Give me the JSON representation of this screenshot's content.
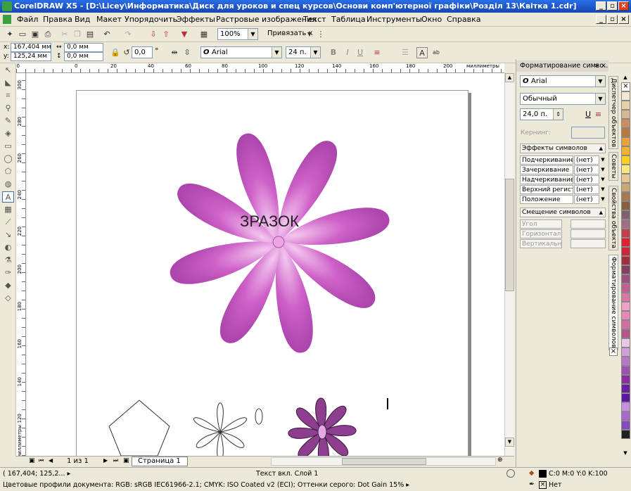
{
  "window": {
    "title": "CorelDRAW X5 - [D:\\Licey\\Информатика\\Диск для уроков и спец курсов\\Основи комп'ютерної графіки\\Розділ 13\\Квітка 1.cdr]"
  },
  "menu": [
    "Файл",
    "Правка",
    "Вид",
    "Макет",
    "Упорядочить",
    "Эффекты",
    "Растровые изображения",
    "Текст",
    "Таблица",
    "Инструменты",
    "Окно",
    "Справка"
  ],
  "toolbar": {
    "zoom": "100%",
    "snap": "Привязать к"
  },
  "propbar": {
    "x": "167,404 мм",
    "y": "125,24 мм",
    "w": "0,0 мм",
    "h": "0,0 мм",
    "angle": "0,0",
    "font": "Arial",
    "size": "24 п."
  },
  "ruler": {
    "h_ticks": [
      "20",
      "0",
      "20",
      "40",
      "60",
      "80",
      "100",
      "120",
      "140",
      "160",
      "180",
      "200"
    ],
    "h_unit": "миллиметры",
    "v_ticks": [
      "300",
      "280",
      "260",
      "240",
      "220",
      "200",
      "180",
      "160",
      "140",
      "120"
    ],
    "v_unit": "миллиметры"
  },
  "canvas": {
    "label": "ЗРАЗОК"
  },
  "nav": {
    "pages": "1 из 1",
    "tab": "Страница 1"
  },
  "docker": {
    "title": "Форматирование симво...",
    "font": "Arial",
    "style": "Обычный",
    "size": "24,0 п.",
    "kerning": "Кернинг:",
    "effects_title": "Эффекты символов",
    "effects": [
      {
        "label": "Подчеркивание",
        "value": "(нет)"
      },
      {
        "label": "Зачеркивание",
        "value": "(нет)"
      },
      {
        "label": "Надчеркивание",
        "value": "(нет)"
      },
      {
        "label": "Верхний регистр",
        "value": "(нет)"
      },
      {
        "label": "Положение",
        "value": "(нет)"
      }
    ],
    "shift_title": "Смещение символов",
    "shifts": [
      "Угол",
      "Горизонтал...",
      "Вертикальн..."
    ]
  },
  "side_tabs": [
    "Диспетчер объектов",
    "Советы",
    "Свойства объекта",
    "Форматирование символов"
  ],
  "palette": [
    "#f5e8d0",
    "#e8d0a8",
    "#d4b896",
    "#c89060",
    "#b87840",
    "#e8a040",
    "#f0b030",
    "#f8d020",
    "#f8e880",
    "#e8c890",
    "#c8a878",
    "#a87850",
    "#886040",
    "#806070",
    "#a07080",
    "#c04050",
    "#e02030",
    "#c82838",
    "#a03040",
    "#804060",
    "#a05080",
    "#c06090",
    "#d878a8",
    "#f0a0c8",
    "#e888b8",
    "#d070a0",
    "#b05888",
    "#e8c8e8",
    "#d0a0d8",
    "#b878c8",
    "#a050b0",
    "#8830a0",
    "#6820a0",
    "#5818a0",
    "#c890e0",
    "#a868d0",
    "#8848c0",
    "#202020"
  ],
  "status": {
    "coords": "( 167,404; 125,2... ▸",
    "layer": "Текст вкл. Слой 1",
    "fill": "C:0 M:0 Y:0 K:100",
    "outline": "Нет",
    "profiles": "Цветовые профили документа: RGB: sRGB IEC61966-2.1; CMYK: ISO Coated v2 (ECI); Оттенки серого: Dot Gain 15% ▸"
  },
  "colors": {
    "petal": "#c860c0",
    "petal_dark": "#a040a0",
    "accent": "#1c55c8"
  }
}
